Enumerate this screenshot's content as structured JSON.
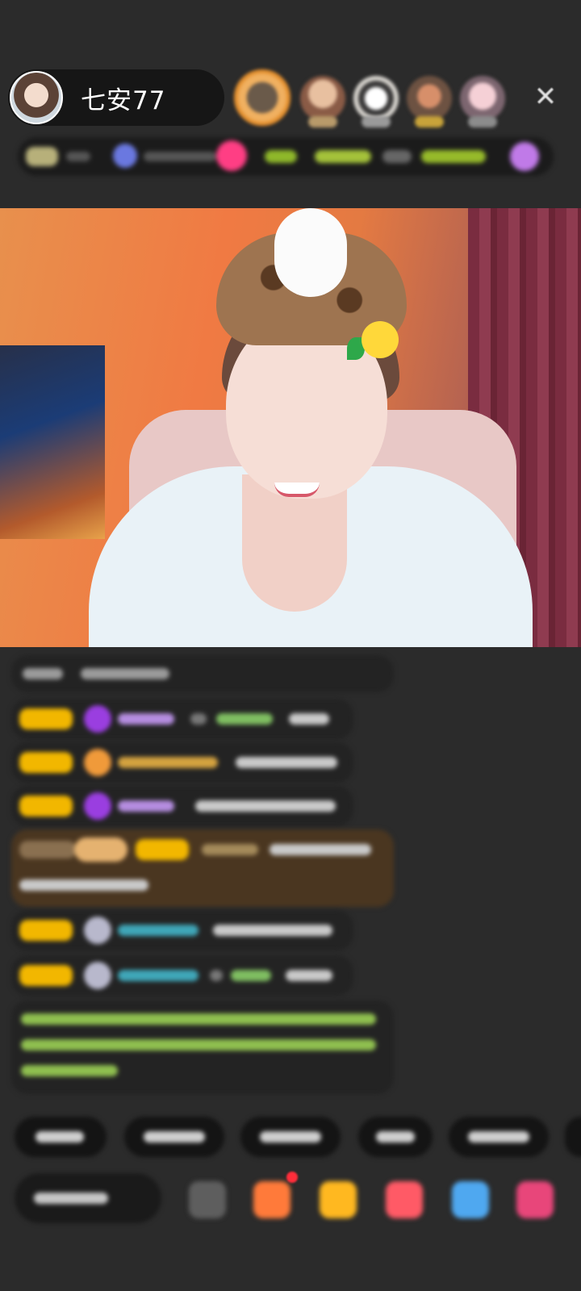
{
  "host": {
    "name": "七安77",
    "avatar_icon": "host-avatar"
  },
  "header": {
    "close_icon": "✕",
    "viewer_avatars": [
      "viewer-1",
      "viewer-2",
      "viewer-3",
      "viewer-4",
      "viewer-5"
    ]
  },
  "colors": {
    "background": "#2b2b2b",
    "pill_dark": "#161616",
    "vip_badge": "#f2b700",
    "gift_highlight": "#4a3620",
    "system_text": "#9ad24b"
  }
}
